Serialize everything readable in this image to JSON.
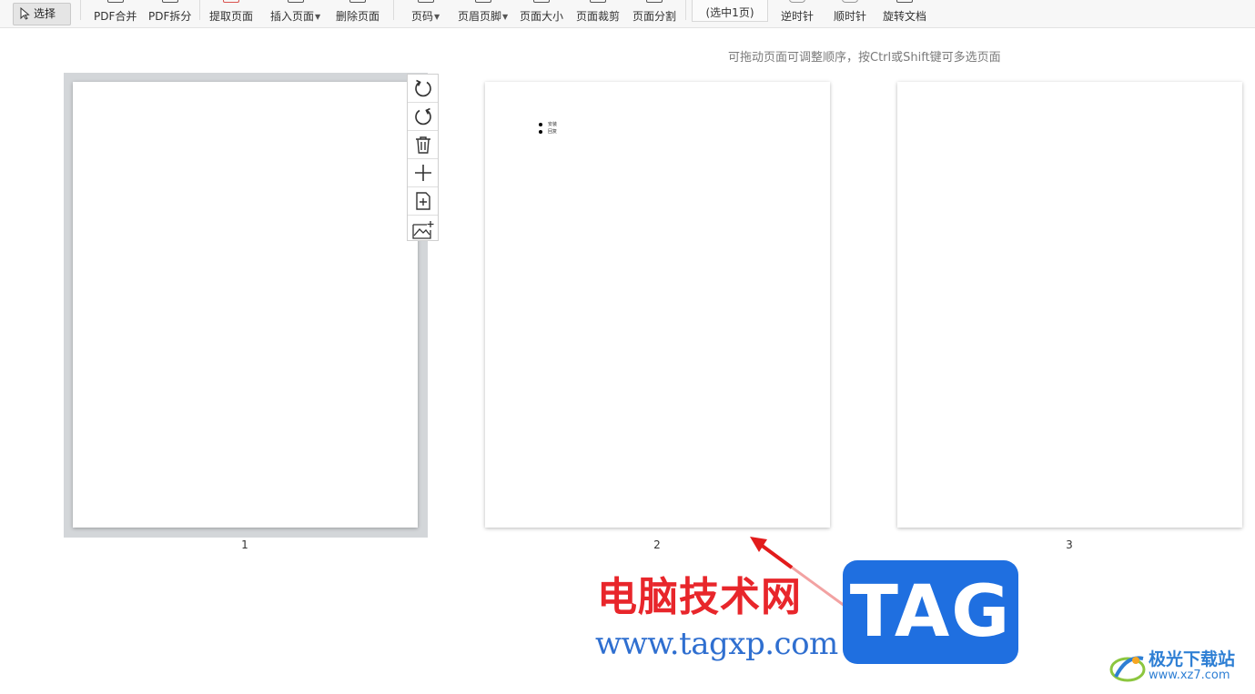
{
  "toolbar": {
    "select": "选择",
    "pdf_merge": "PDF合并",
    "pdf_split": "PDF拆分",
    "extract_pages": "提取页面",
    "insert_pages": "插入页面",
    "delete_pages": "删除页面",
    "page_number": "页码",
    "header_footer": "页眉页脚",
    "page_size": "页面大小",
    "page_crop": "页面裁剪",
    "page_split": "页面分割",
    "selected_count": "(选中1页)",
    "counterclockwise": "逆时针",
    "clockwise": "顺时针",
    "rotate_doc": "旋转文档"
  },
  "hint": "可拖动页面可调整顺序，按Ctrl或Shift键可多选页面",
  "pages": [
    {
      "number": "1",
      "selected": true,
      "content": []
    },
    {
      "number": "2",
      "selected": false,
      "content": [
        "安装",
        "回复"
      ]
    },
    {
      "number": "3",
      "selected": false,
      "content": []
    }
  ],
  "page_actions": [
    "rotate-counterclockwise-icon",
    "rotate-clockwise-icon",
    "delete-icon",
    "add-icon",
    "insert-page-icon",
    "insert-image-icon"
  ],
  "watermark": {
    "site_cn": "电脑技术网",
    "site_url": "www.tagxp.com",
    "tag": "TAG",
    "brand_cn": "极光下载站",
    "brand_url": "www.xz7.com"
  },
  "colors": {
    "accent_red": "#e8262b",
    "tag_blue": "#1f6fe0",
    "selected_frame": "#d3d6d9"
  }
}
